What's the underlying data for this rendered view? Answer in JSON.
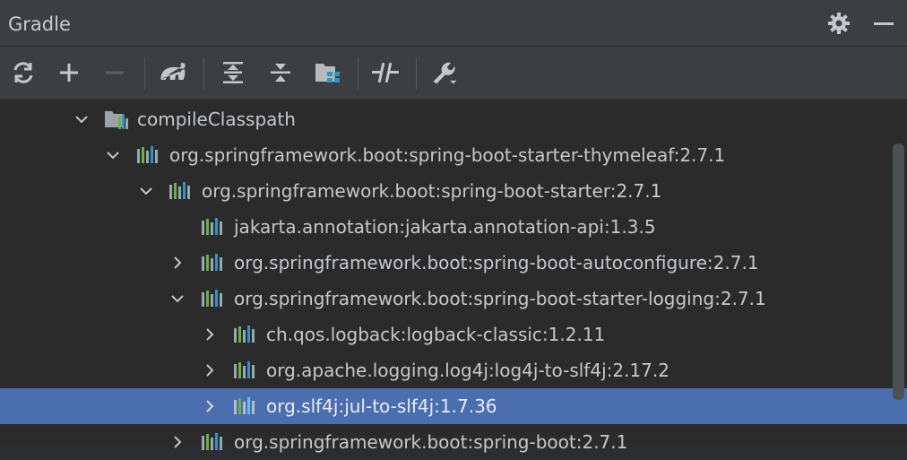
{
  "panel": {
    "title": "Gradle"
  },
  "header_icons": [
    "gear-icon",
    "minimize-icon"
  ],
  "toolbar": {
    "buttons": [
      "reload-icon",
      "add-icon",
      "remove-icon",
      "elephant-icon",
      "expand-all-icon",
      "collapse-all-icon",
      "project-structure-icon",
      "toggle-offline-icon",
      "settings-wrench-icon"
    ]
  },
  "colors": {
    "selection": "#4b6eaf",
    "background": "#2b2b2b",
    "toolbar": "#3c3f41"
  },
  "tree": {
    "rows": [
      {
        "label": "compileClasspath",
        "expanded": true
      },
      {
        "label": "org.springframework.boot:spring-boot-starter-thymeleaf:2.7.1",
        "expanded": true
      },
      {
        "label": "org.springframework.boot:spring-boot-starter:2.7.1",
        "expanded": true
      },
      {
        "label": "jakarta.annotation:jakarta.annotation-api:1.3.5",
        "expanded": false
      },
      {
        "label": "org.springframework.boot:spring-boot-autoconfigure:2.7.1",
        "expanded": false
      },
      {
        "label": "org.springframework.boot:spring-boot-starter-logging:2.7.1",
        "expanded": true
      },
      {
        "label": "ch.qos.logback:logback-classic:1.2.11",
        "expanded": false
      },
      {
        "label": "org.apache.logging.log4j:log4j-to-slf4j:2.17.2",
        "expanded": false
      },
      {
        "label": "org.slf4j:jul-to-slf4j:1.7.36",
        "expanded": false,
        "selected": true
      },
      {
        "label": "org.springframework.boot:spring-boot:2.7.1",
        "expanded": false
      }
    ]
  }
}
